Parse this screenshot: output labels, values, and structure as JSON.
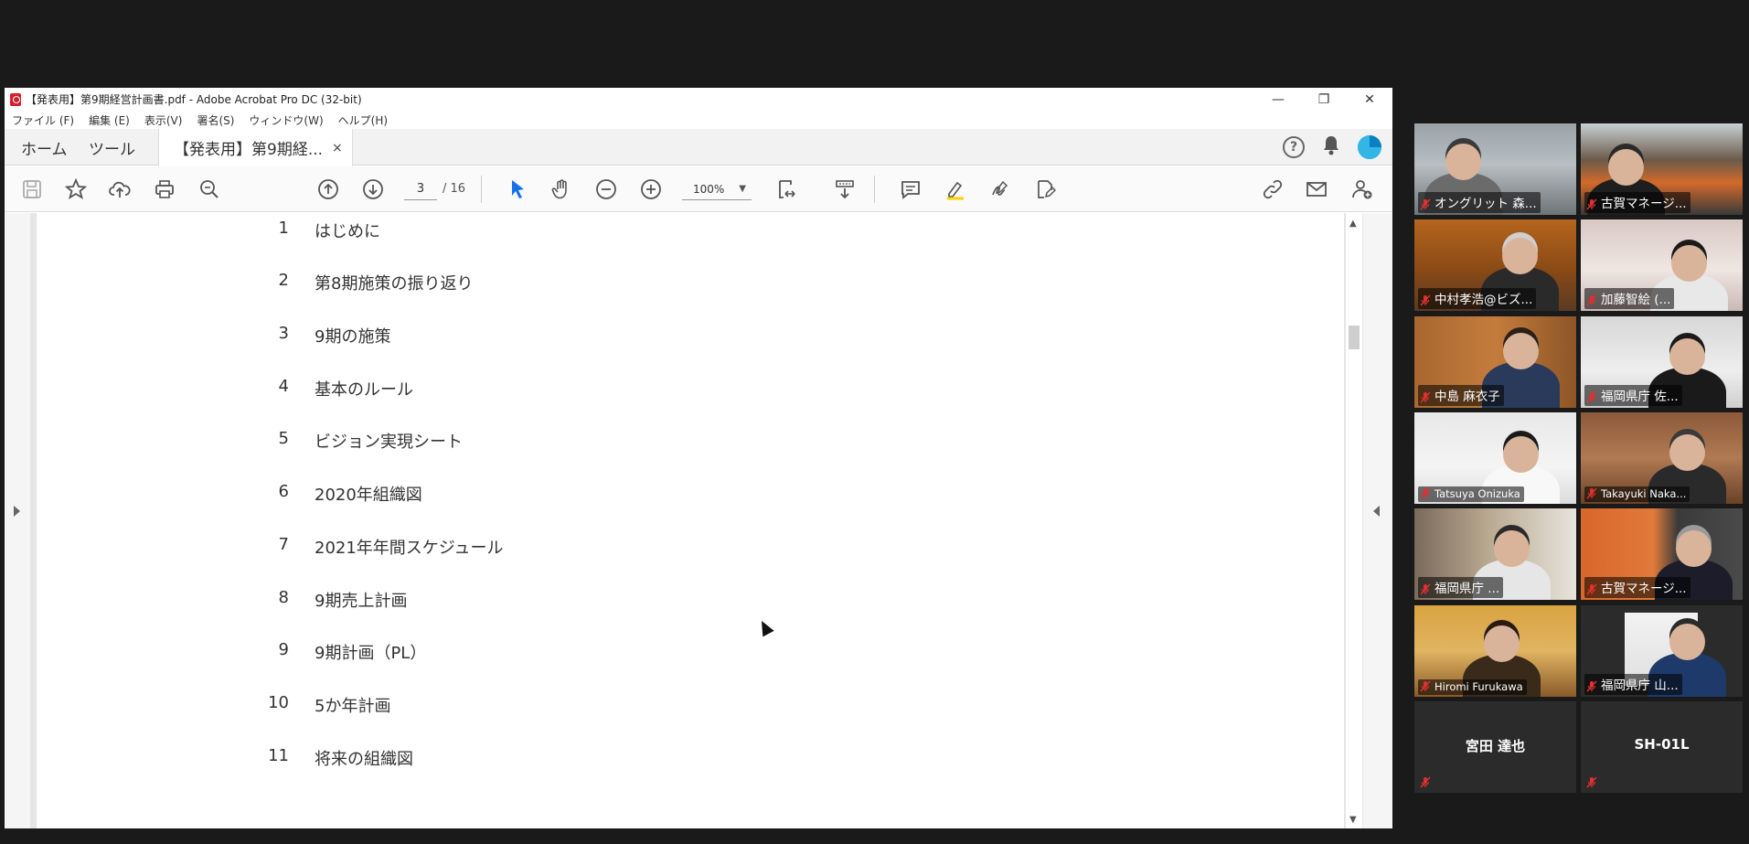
{
  "window": {
    "title": "【発表用】第9期経営計画書.pdf - Adobe Acrobat Pro DC (32-bit)",
    "controls": {
      "minimize": "—",
      "restore": "❐",
      "close": "✕"
    }
  },
  "menu": [
    "ファイル (F)",
    "編集 (E)",
    "表示(V)",
    "署名(S)",
    "ウィンドウ(W)",
    "ヘルプ(H)"
  ],
  "tabs": {
    "home": "ホーム",
    "tools": "ツール",
    "document": "【発表用】第9期経...",
    "close": "×"
  },
  "toolbar": {
    "page_current": "3",
    "page_total": "/ 16",
    "zoom": "100%"
  },
  "toc": [
    {
      "num": "1",
      "text": "はじめに"
    },
    {
      "num": "2",
      "text": "第8期施策の振り返り"
    },
    {
      "num": "3",
      "text": "9期の施策"
    },
    {
      "num": "4",
      "text": "基本のルール"
    },
    {
      "num": "5",
      "text": "ビジョン実現シート"
    },
    {
      "num": "6",
      "text": "2020年組織図"
    },
    {
      "num": "7",
      "text": "2021年年間スケジュール"
    },
    {
      "num": "8",
      "text": "9期売上計画"
    },
    {
      "num": "9",
      "text": "9期計画（PL）"
    },
    {
      "num": "10",
      "text": "5か年計画"
    },
    {
      "num": "11",
      "text": "将来の組織図"
    }
  ],
  "participants": [
    {
      "name": "オングリット 森..."
    },
    {
      "name": "古賀マネージ..."
    },
    {
      "name": "中村孝浩@ビズ..."
    },
    {
      "name": "加藤智絵 (..."
    },
    {
      "name": "中島 麻衣子"
    },
    {
      "name": "福岡県庁 佐..."
    },
    {
      "name": "Tatsuya Onizuka"
    },
    {
      "name": "Takayuki Naka..."
    },
    {
      "name": "福岡県庁 ..."
    },
    {
      "name": "古賀マネージ..."
    },
    {
      "name": "Hiromi Furukawa"
    },
    {
      "name": "福岡県庁 山..."
    },
    {
      "name": "宮田 達也"
    },
    {
      "name": "SH-01L"
    }
  ]
}
